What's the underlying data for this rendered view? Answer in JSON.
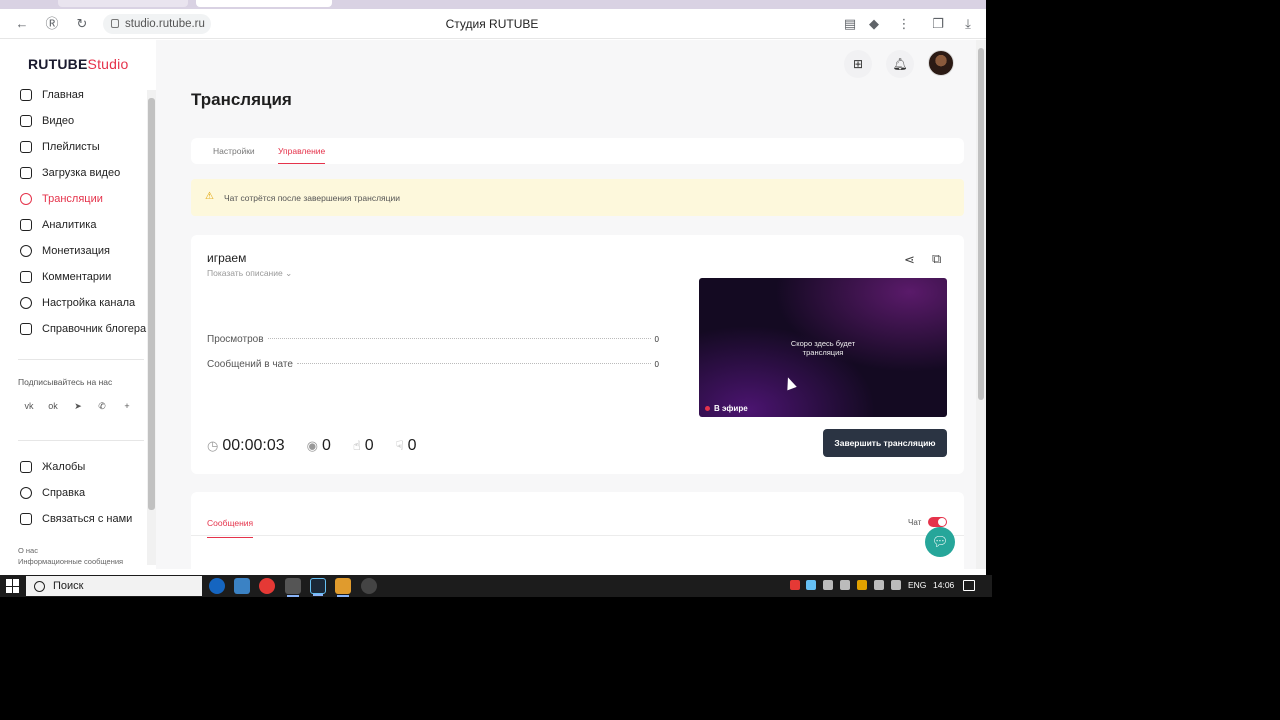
{
  "browser": {
    "url": "studio.rutube.ru",
    "title": "Студия RUTUBE"
  },
  "sidebar": {
    "logo_main": "RUTUBE",
    "logo_accent": "Studio",
    "items": [
      {
        "label": "Главная",
        "icon": "home-icon"
      },
      {
        "label": "Видео",
        "icon": "video-icon"
      },
      {
        "label": "Плейлисты",
        "icon": "playlist-icon"
      },
      {
        "label": "Загрузка видео",
        "icon": "upload-icon"
      },
      {
        "label": "Трансляции",
        "icon": "broadcast-icon",
        "active": true
      },
      {
        "label": "Аналитика",
        "icon": "analytics-icon"
      },
      {
        "label": "Монетизация",
        "icon": "money-icon"
      },
      {
        "label": "Комментарии",
        "icon": "comment-icon"
      },
      {
        "label": "Настройка канала",
        "icon": "gear-icon"
      },
      {
        "label": "Справочник блогера",
        "icon": "info-icon"
      }
    ],
    "follow_label": "Подписывайтесь на нас",
    "socials": [
      "vk-icon",
      "ok-icon",
      "telegram-icon",
      "viber-icon",
      "plus-icon"
    ],
    "bottom_items": [
      {
        "label": "Жалобы",
        "icon": "flag-icon"
      },
      {
        "label": "Справка",
        "icon": "help-icon"
      },
      {
        "label": "Связаться с нами",
        "icon": "mail-icon"
      }
    ],
    "small_links": [
      "О нас",
      "Информационные сообщения"
    ]
  },
  "page": {
    "title": "Трансляция",
    "tabs": [
      "Настройки",
      "Управление"
    ],
    "active_tab": "Управление",
    "warning": "Чат сотрётся после завершения трансляции"
  },
  "stream": {
    "title": "играем",
    "show_description": "Показать описание",
    "stats": [
      {
        "label": "Просмотров",
        "value": "0"
      },
      {
        "label": "Сообщений в чате",
        "value": "0"
      }
    ],
    "duration": "00:00:03",
    "viewers": "0",
    "likes": "0",
    "dislikes": "0",
    "preview_text": "Скоро здесь будет трансляция",
    "live_badge": "В эфире",
    "end_button": "Завершить трансляцию"
  },
  "messages": {
    "tab_label": "Сообщения",
    "chat_label": "Чат",
    "chat_enabled": true
  },
  "taskbar": {
    "search_placeholder": "Поиск",
    "language": "ENG",
    "time": "14:06"
  },
  "colors": {
    "accent": "#e5334b",
    "warning_bg": "#fdf8dc",
    "dark_button": "#2b3443",
    "support": "#26a69a"
  }
}
